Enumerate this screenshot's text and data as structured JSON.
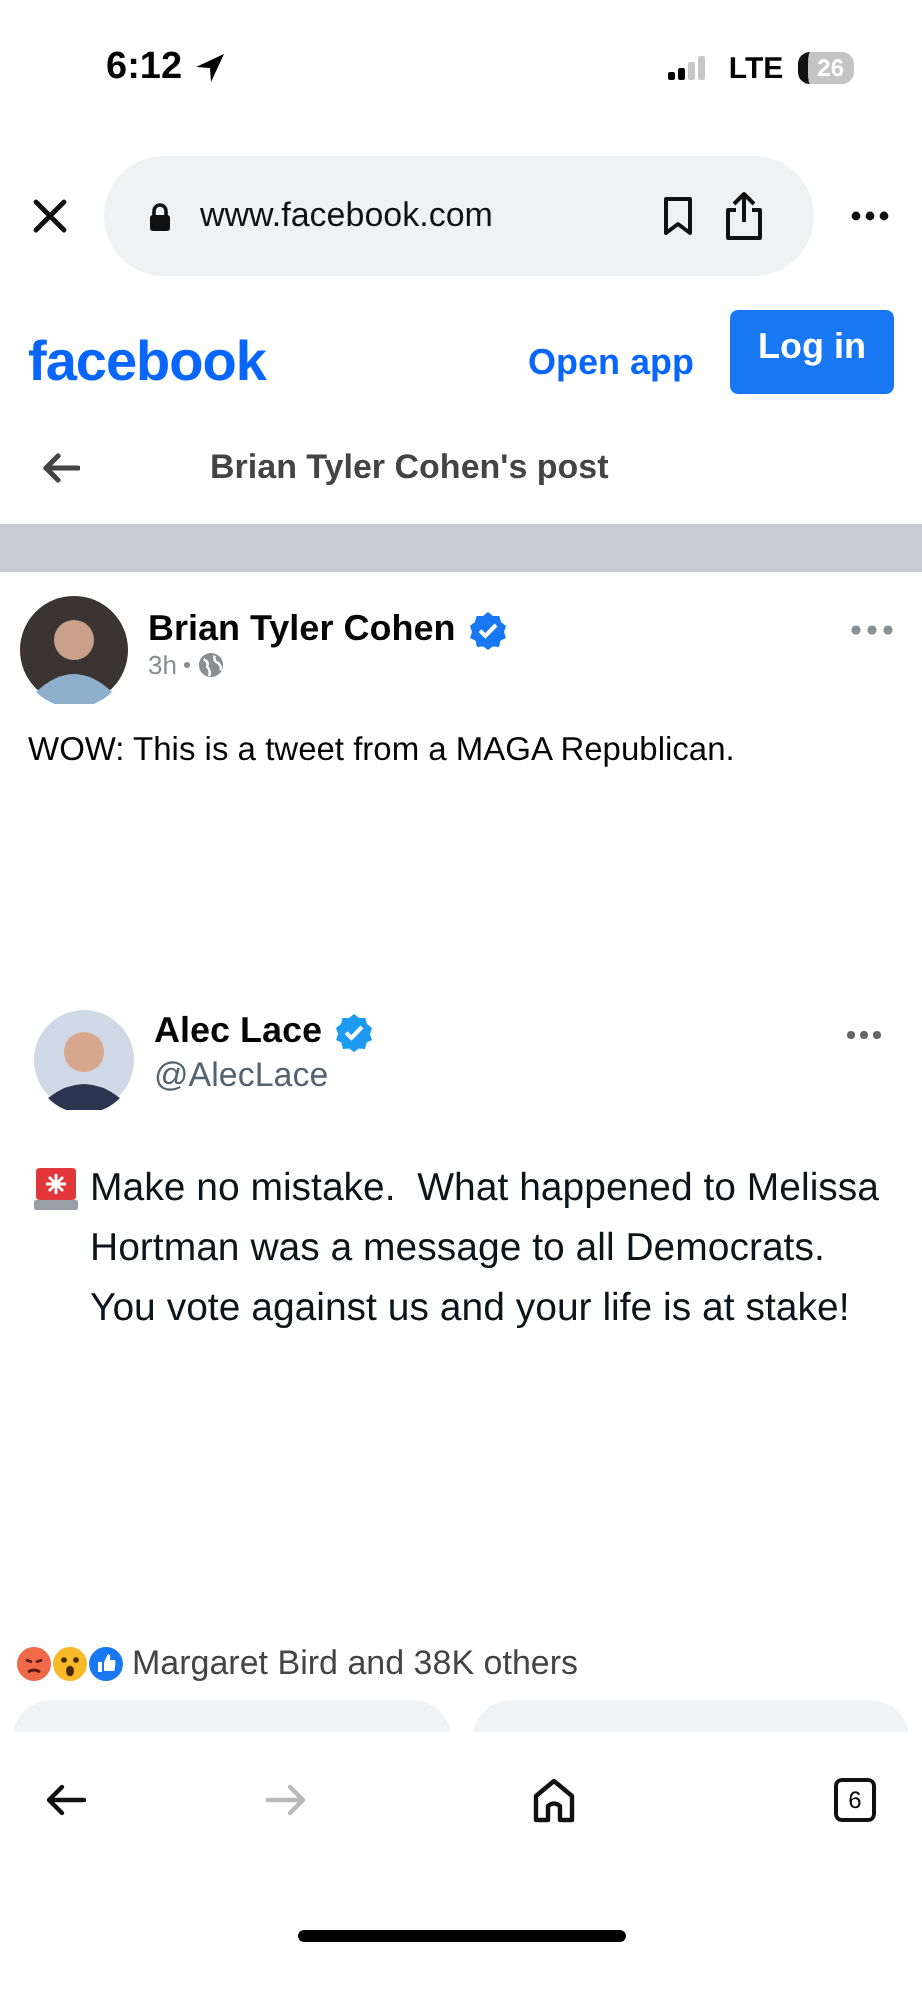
{
  "status_bar": {
    "time": "6:12",
    "network": "LTE",
    "battery": "26"
  },
  "browser": {
    "url": "www.facebook.com",
    "tab_count": "6",
    "forward_disabled": true
  },
  "header": {
    "logo": "facebook",
    "open_app": "Open app",
    "login": "Log in"
  },
  "page_title": "Brian Tyler Cohen's post",
  "post": {
    "author": "Brian Tyler Cohen",
    "verified": true,
    "time": "3h",
    "text": "WOW: This is a tweet from a MAGA Republican.",
    "embedded_tweet": {
      "author": "Alec Lace",
      "verified": true,
      "handle": "@AlecLace",
      "text": "Make no mistake.  What happened to Melissa Hortman was a message to all Democrats.  You vote against us and your life is at stake!"
    },
    "reactions": "Margaret Bird and 38K others"
  }
}
